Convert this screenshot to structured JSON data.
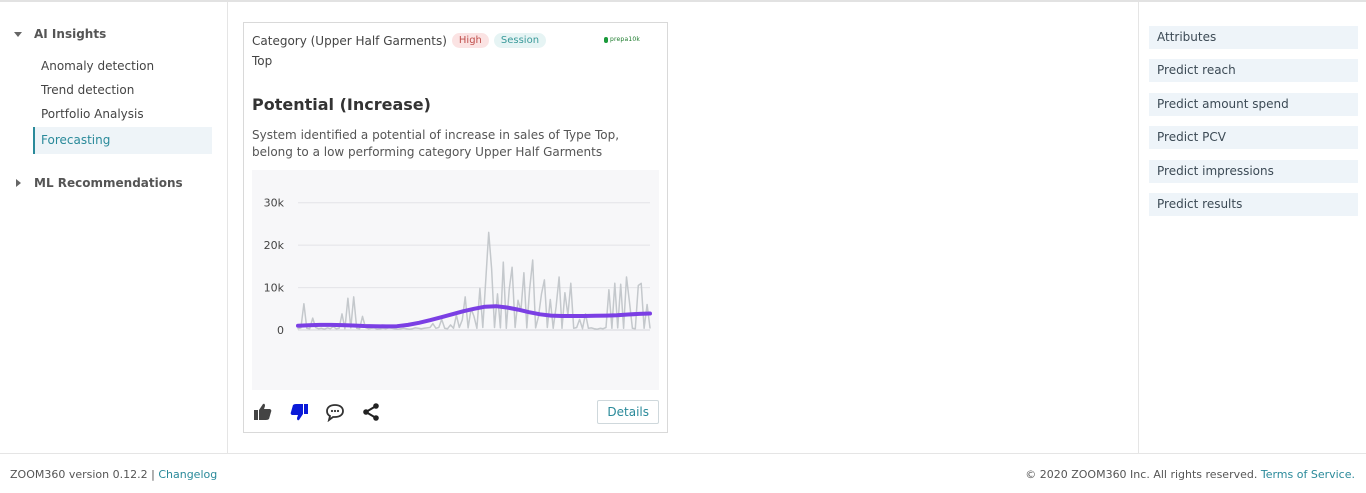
{
  "sidebar": {
    "ai_insights": {
      "label": "AI Insights"
    },
    "items": [
      {
        "label": "Anomaly detection"
      },
      {
        "label": "Trend detection"
      },
      {
        "label": "Portfolio Analysis"
      },
      {
        "label": "Forecasting",
        "active": true
      }
    ],
    "ml_recommendations": {
      "label": "ML Recommendations"
    }
  },
  "card": {
    "category": "Category (Upper Half Garments)",
    "badge_high": "High",
    "badge_session": "Session",
    "subtitle": "Top",
    "title": "Potential (Increase)",
    "description": "System identified a potential of increase in sales of Type Top, belong to a low performing category Upper Half Garments",
    "details_label": "Details",
    "icons": [
      "thumbs-up-icon",
      "thumbs-down-icon",
      "comment-icon",
      "share-icon"
    ]
  },
  "chart_data": {
    "type": "line",
    "yticks": [
      "30k",
      "20k",
      "10k",
      "0"
    ],
    "ylim": [
      0,
      33000
    ],
    "grid": true,
    "colors": {
      "actual": "#c4c8cc",
      "forecast": "#7b3fe4"
    },
    "series": [
      {
        "values": [
          300,
          500,
          6200,
          400,
          300,
          2800,
          600,
          300,
          400,
          200,
          500,
          300,
          800,
          300,
          400,
          3800,
          300,
          7500,
          500,
          7800,
          400,
          300,
          3200,
          600,
          300,
          400,
          500,
          200,
          300,
          400,
          300,
          500,
          400,
          300,
          200,
          300,
          400,
          300,
          200,
          300,
          500,
          400,
          300,
          400,
          500,
          600,
          1500,
          400,
          600,
          2500,
          400,
          300,
          1200,
          400,
          3500,
          600,
          2400,
          7800,
          500,
          5000,
          3200,
          400,
          9800,
          600,
          11500,
          23000,
          14500,
          600,
          8500,
          500,
          16000,
          400,
          9500,
          14800,
          600,
          7000,
          4500,
          13500,
          500,
          9800,
          16500,
          500,
          3200,
          8500,
          11800,
          600,
          7200,
          400,
          5500,
          12500,
          400,
          8800,
          3500,
          11000,
          400,
          600,
          2500,
          300,
          3800,
          400,
          500,
          300,
          200,
          400,
          300,
          600,
          9500,
          400,
          11000,
          500,
          10800,
          400,
          12500,
          6500,
          400,
          300,
          10500,
          11000,
          400,
          6000,
          500
        ]
      },
      {
        "values": [
          1000,
          1100,
          1200,
          1200,
          1150,
          1050,
          950,
          900,
          850,
          900,
          1200,
          1700,
          2300,
          3000,
          3700,
          4400,
          5000,
          5500,
          5600,
          5300,
          4800,
          4200,
          3700,
          3400,
          3300,
          3300,
          3300,
          3350,
          3400,
          3500,
          3650,
          3800,
          3900
        ]
      }
    ]
  },
  "right_panel": {
    "items": [
      {
        "label": "Attributes"
      },
      {
        "label": "Predict reach"
      },
      {
        "label": "Predict amount spend"
      },
      {
        "label": "Predict PCV"
      },
      {
        "label": "Predict impressions"
      },
      {
        "label": "Predict results"
      }
    ]
  },
  "footer": {
    "version": "ZOOM360 version 0.12.2",
    "separator": "|",
    "changelog": "Changelog",
    "copyright": "© 2020 ZOOM360 Inc. All rights reserved.",
    "terms": "Terms of Service."
  }
}
